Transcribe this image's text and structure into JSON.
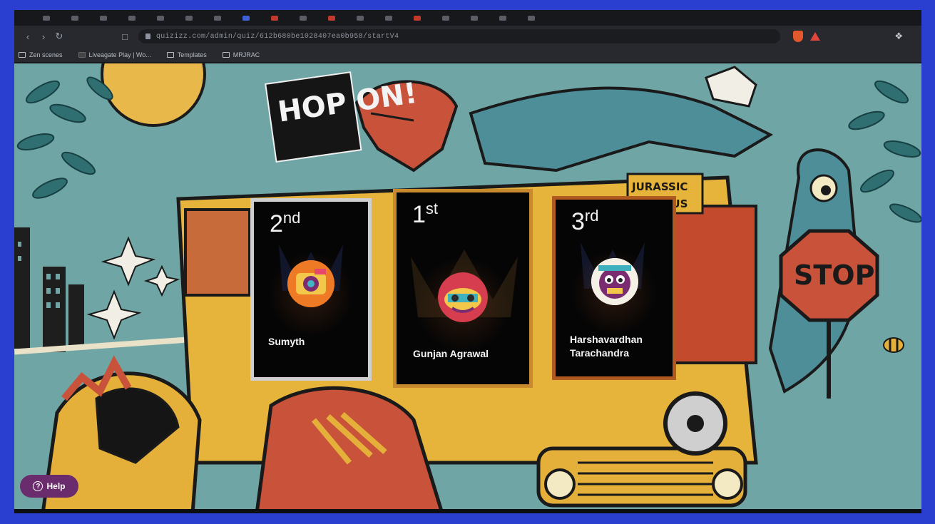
{
  "browser": {
    "url": "quizizz.com/admin/quiz/612b680be1028407ea0b958/startV4",
    "bookmarks": [
      {
        "label": "Zen scenes"
      },
      {
        "label": "Liveagate Play | Wo..."
      },
      {
        "label": "Templates"
      },
      {
        "label": "MRJRAC"
      }
    ]
  },
  "scene": {
    "sign_text": "HOP ON!",
    "bus_text": "JURASSIC BUS",
    "stop_text": "STOP"
  },
  "podium": [
    {
      "rank": "2",
      "suffix": "nd",
      "name": "Sumyth"
    },
    {
      "rank": "1",
      "suffix": "st",
      "name": "Gunjan Agrawal"
    },
    {
      "rank": "3",
      "suffix": "rd",
      "name_line1": "Harshavardhan",
      "name_line2": "Tarachandra"
    }
  ],
  "help": {
    "label": "Help"
  },
  "colors": {
    "border": "#2a3fd0",
    "first_border": "#c98a2e",
    "second_border": "#cfcfcf",
    "third_border": "#b05a22",
    "help_bg": "#6b2c6d"
  }
}
